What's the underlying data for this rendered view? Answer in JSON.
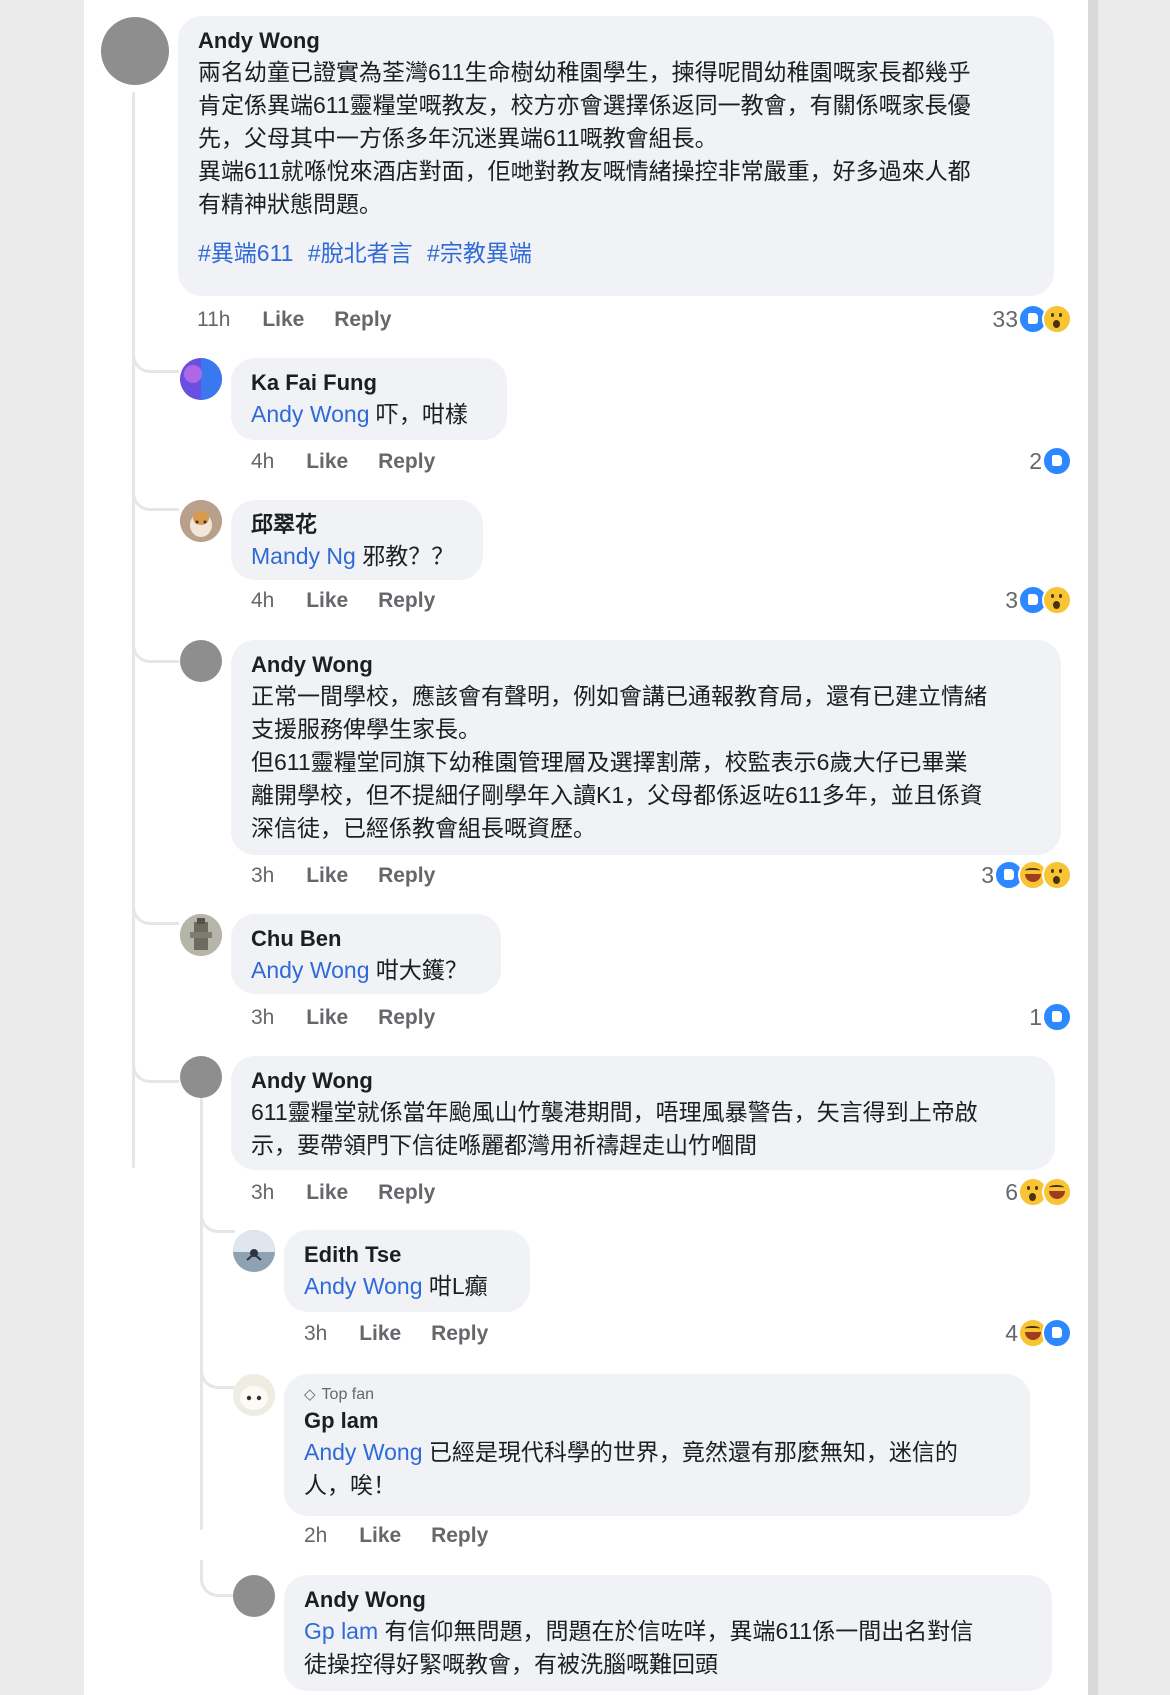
{
  "actions": {
    "like": "Like",
    "reply": "Reply"
  },
  "comments": [
    {
      "author": "Andy Wong",
      "lines": [
        "兩名幼童已證實為荃灣611生命樹幼稚園學生，揀得呢間幼稚園嘅家長都幾乎",
        "肯定係異端611靈糧堂嘅教友，校方亦會選擇係返同一教會，有關係嘅家長優",
        "先，父母其中一方係多年沉迷異端611嘅教會組長。",
        "異端611就喺悅來酒店對面，佢哋對教友嘅情緒操控非常嚴重，好多過來人都",
        "有精神狀態問題。"
      ],
      "hashtags": [
        "#異端611",
        "#脫北者言",
        "#宗教異端"
      ],
      "time": "11h",
      "reaction_count": "33",
      "reactions": [
        "like",
        "wow"
      ]
    },
    {
      "author": "Ka Fai Fung",
      "mention": "Andy Wong",
      "text": "吓，咁樣",
      "time": "4h",
      "reaction_count": "2",
      "reactions": [
        "like"
      ]
    },
    {
      "author": "邱翠花",
      "mention": "Mandy Ng",
      "text": "邪教？？",
      "time": "4h",
      "reaction_count": "3",
      "reactions": [
        "like",
        "wow"
      ]
    },
    {
      "author": "Andy Wong",
      "lines": [
        "正常一間學校，應該會有聲明，例如會講已通報教育局，還有已建立情緒",
        "支援服務俾學生家長。",
        "但611靈糧堂同旗下幼稚園管理層及選擇割蓆，校監表示6歲大仔已畢業",
        "離開學校，但不提細仔剛學年入讀K1，父母都係返咗611多年，並且係資",
        "深信徒，已經係教會組長嘅資歷。"
      ],
      "time": "3h",
      "reaction_count": "3",
      "reactions": [
        "like",
        "haha",
        "wow"
      ]
    },
    {
      "author": "Chu Ben",
      "mention": "Andy Wong",
      "text": "咁大鑊？",
      "time": "3h",
      "reaction_count": "1",
      "reactions": [
        "like"
      ]
    },
    {
      "author": "Andy Wong",
      "lines": [
        "611靈糧堂就係當年颱風山竹襲港期間，唔理風暴警告，矢言得到上帝啟",
        "示，要帶領門下信徒喺麗都灣用祈禱趕走山竹嗰間"
      ],
      "time": "3h",
      "reaction_count": "6",
      "reactions": [
        "wow",
        "haha"
      ]
    },
    {
      "author": "Edith Tse",
      "mention": "Andy Wong",
      "text": "咁L癲",
      "time": "3h",
      "reaction_count": "4",
      "reactions": [
        "haha",
        "like"
      ]
    },
    {
      "badge": "Top fan",
      "author": "Gp lam",
      "mention": "Andy Wong",
      "text": "已經是現代科學的世界，竟然還有那麼無知，迷信的",
      "text2": "人，唉！",
      "time": "2h"
    },
    {
      "author": "Andy Wong",
      "mention": "Gp lam",
      "text": "有信仰無問題，問題在於信咗咩，異端611係一間出名對信",
      "text2": "徒操控得好緊嘅教會，有被洗腦嘅難回頭"
    }
  ],
  "colors": {
    "link": "#2f6ad6",
    "bubble": "#f0f2f5",
    "like_blue": "#2d88ff",
    "emoji_yellow": "#f7c433"
  }
}
